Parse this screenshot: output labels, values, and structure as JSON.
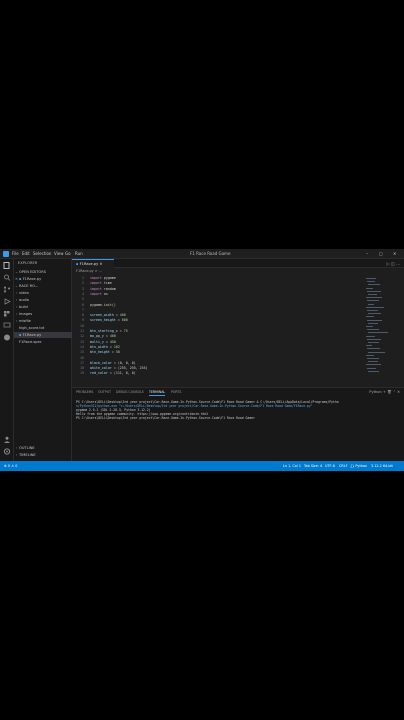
{
  "menu": [
    "File",
    "Edit",
    "Selection",
    "View",
    "Go",
    "Run"
  ],
  "window_title": "F1 Race Road Game",
  "sidebar": {
    "explorer_title": "EXPLORER",
    "open_editors": "OPEN EDITORS",
    "open_file": "F1Race.py",
    "folder": "RACE RO...",
    "items": [
      {
        "label": "video",
        "kind": "folder"
      },
      {
        "label": "audio",
        "kind": "folder"
      },
      {
        "label": "build",
        "kind": "folder"
      },
      {
        "label": "images",
        "kind": "folder"
      },
      {
        "label": "misfile",
        "kind": "folder"
      },
      {
        "label": "high_score.txt",
        "kind": "file"
      },
      {
        "label": "F1Race.py",
        "kind": "py"
      },
      {
        "label": "F1Race.spec",
        "kind": "file"
      }
    ],
    "outline": "OUTLINE",
    "timeline": "TIMELINE"
  },
  "editor": {
    "tab_label": "F1Race.py",
    "breadcrumb": "F1Race.py > ...",
    "lines": [
      {
        "n": "1",
        "code": "import pygame"
      },
      {
        "n": "2",
        "code": "import time"
      },
      {
        "n": "3",
        "code": "import random"
      },
      {
        "n": "4",
        "code": "import os"
      },
      {
        "n": "5",
        "code": ""
      },
      {
        "n": "6",
        "code": "pygame.init()"
      },
      {
        "n": "7",
        "code": ""
      },
      {
        "n": "8",
        "code": "screen_width = 400"
      },
      {
        "n": "9",
        "code": "screen_height = 600"
      },
      {
        "n": "10",
        "code": ""
      },
      {
        "n": "11",
        "code": "btn_starting_x = 75"
      },
      {
        "n": "12",
        "code": "mo_pp_y = 400"
      },
      {
        "n": "13",
        "code": "multi_y = 450"
      },
      {
        "n": "14",
        "code": "btn_width = 162"
      },
      {
        "n": "15",
        "code": "btn_height = 50"
      },
      {
        "n": "16",
        "code": ""
      },
      {
        "n": "17",
        "code": "black_color = (0, 0, 0)"
      },
      {
        "n": "18",
        "code": "white_color = (255, 255, 255)"
      },
      {
        "n": "19",
        "code": "red_color = (111, 0, 0)"
      }
    ]
  },
  "panel": {
    "tabs": [
      "PROBLEMS",
      "OUTPUT",
      "DEBUG CONSOLE",
      "TERMINAL",
      "PORTS"
    ],
    "active_tab": "TERMINAL",
    "shell": "Python",
    "terminal_lines": [
      "PS C:\\Users\\DELL\\Desktop\\3rd year project\\Car-Race-Game-In-Python-Source-Code\\F1 Race Road Game> & C:/Users/DELL/AppData/Local/Programs/Pytho",
      "n/Python312/python.exe \"c:/Users/DELL/Desktop/3rd year project/Car-Race-Game-In-Python-Source-Code/F1 Race Road Game/F1Race.py\"",
      "pygame 2.5.2 (SDL 2.28.3, Python 3.12.2)",
      "Hello from the pygame community. https://www.pygame.org/contribute.html",
      "PS C:\\Users\\DELL\\Desktop\\3rd year project\\Car-Race-Game-In-Python-Source-Code\\F1 Race Road Game>"
    ]
  },
  "statusbar": {
    "left": "⊗ 0 ⚠ 0",
    "position": "Ln 1, Col 1",
    "spaces": "Tab Size: 4",
    "encoding": "UTF-8",
    "eol": "CRLF",
    "language": "{} Python",
    "interpreter": "3.12.2 64-bit"
  }
}
